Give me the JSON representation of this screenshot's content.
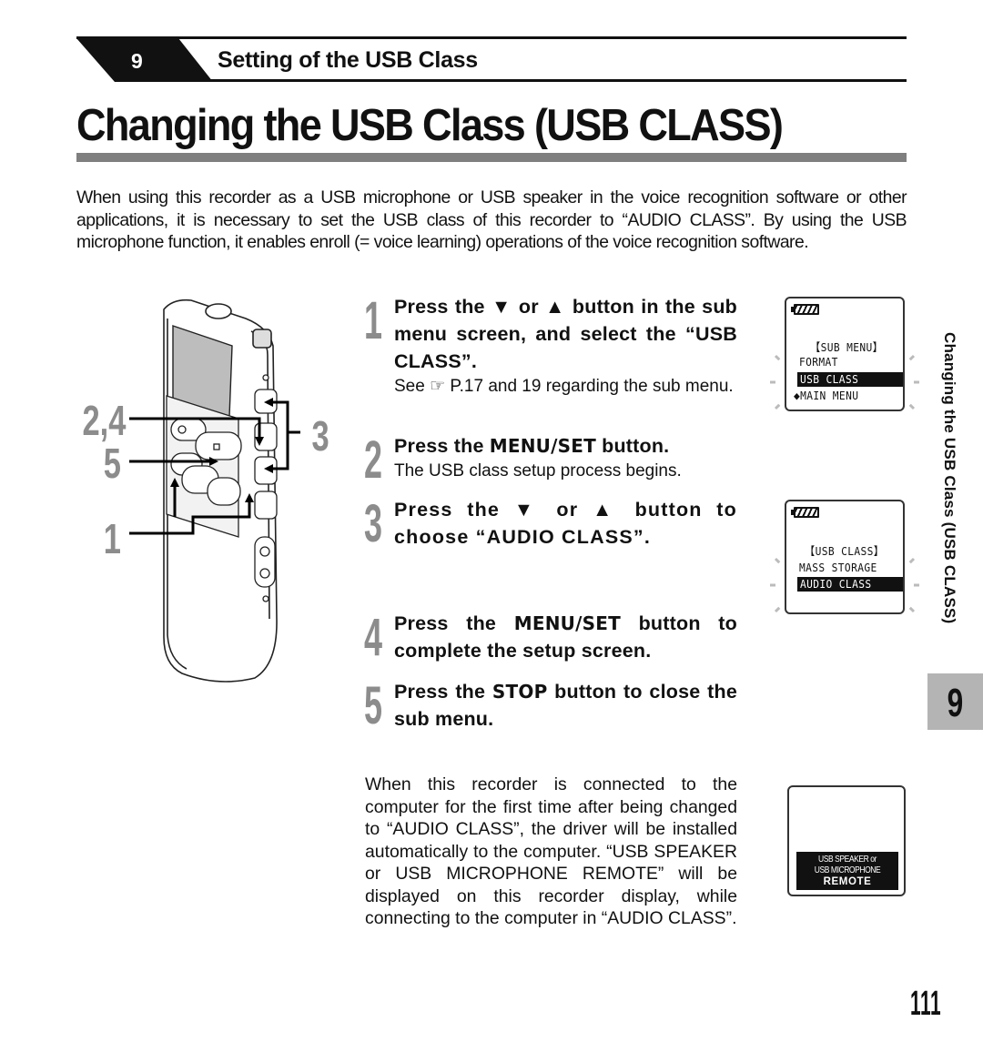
{
  "section": {
    "number": "9",
    "title": "Setting of the USB Class"
  },
  "page_title": "Changing the USB Class (USB CLASS)",
  "intro": "When using this recorder as a USB microphone or USB speaker in the voice recognition software or other applications, it is necessary to set the USB class of this recorder to “AUDIO CLASS”. By using the USB microphone function, it enables enroll (= voice learning) operations of the voice recognition software.",
  "illustration": {
    "callouts": [
      "2,4",
      "5",
      "1",
      "3"
    ]
  },
  "steps": [
    {
      "number": "1",
      "main_parts": [
        "Press the ▼ or ▲ button in the sub menu screen, and select the “USB CLASS”."
      ],
      "sub": "See ☞ P.17 and 19 regarding the sub menu."
    },
    {
      "number": "2",
      "pre": "Press the ",
      "button": "MENU/SET",
      "post": " button.",
      "sub": "The USB class setup process begins."
    },
    {
      "number": "3",
      "main": "Press the ▼ or ▲ button to choose “AUDIO CLASS”."
    },
    {
      "number": "4",
      "pre": "Press the ",
      "button": "MENU/SET",
      "post": " button to complete the setup screen."
    },
    {
      "number": "5",
      "pre": "Press the ",
      "button": "STOP",
      "post": " button to close the sub menu."
    }
  ],
  "lcd_screens": [
    {
      "heading": "【SUB MENU】",
      "items": [
        "FORMAT",
        "USB CLASS",
        "◆MAIN MENU"
      ],
      "selected": "USB CLASS"
    },
    {
      "heading": "【USB CLASS】",
      "items": [
        "MASS STORAGE",
        "AUDIO CLASS"
      ],
      "selected": "AUDIO CLASS"
    },
    {
      "lines": [
        "USB SPEAKER or",
        "USB MICROPHONE",
        "REMOTE"
      ]
    }
  ],
  "note": "When this recorder is connected to the computer for the first time after being changed to “AUDIO CLASS”, the driver will be installed automatically to the computer. “USB SPEAKER or USB MICROPHONE REMOTE” will be displayed on this recorder display, while connecting to the computer in  “AUDIO CLASS”.",
  "side_tab": {
    "label": "Changing the USB Class (USB CLASS)",
    "chapter": "9"
  },
  "page_number": "111"
}
